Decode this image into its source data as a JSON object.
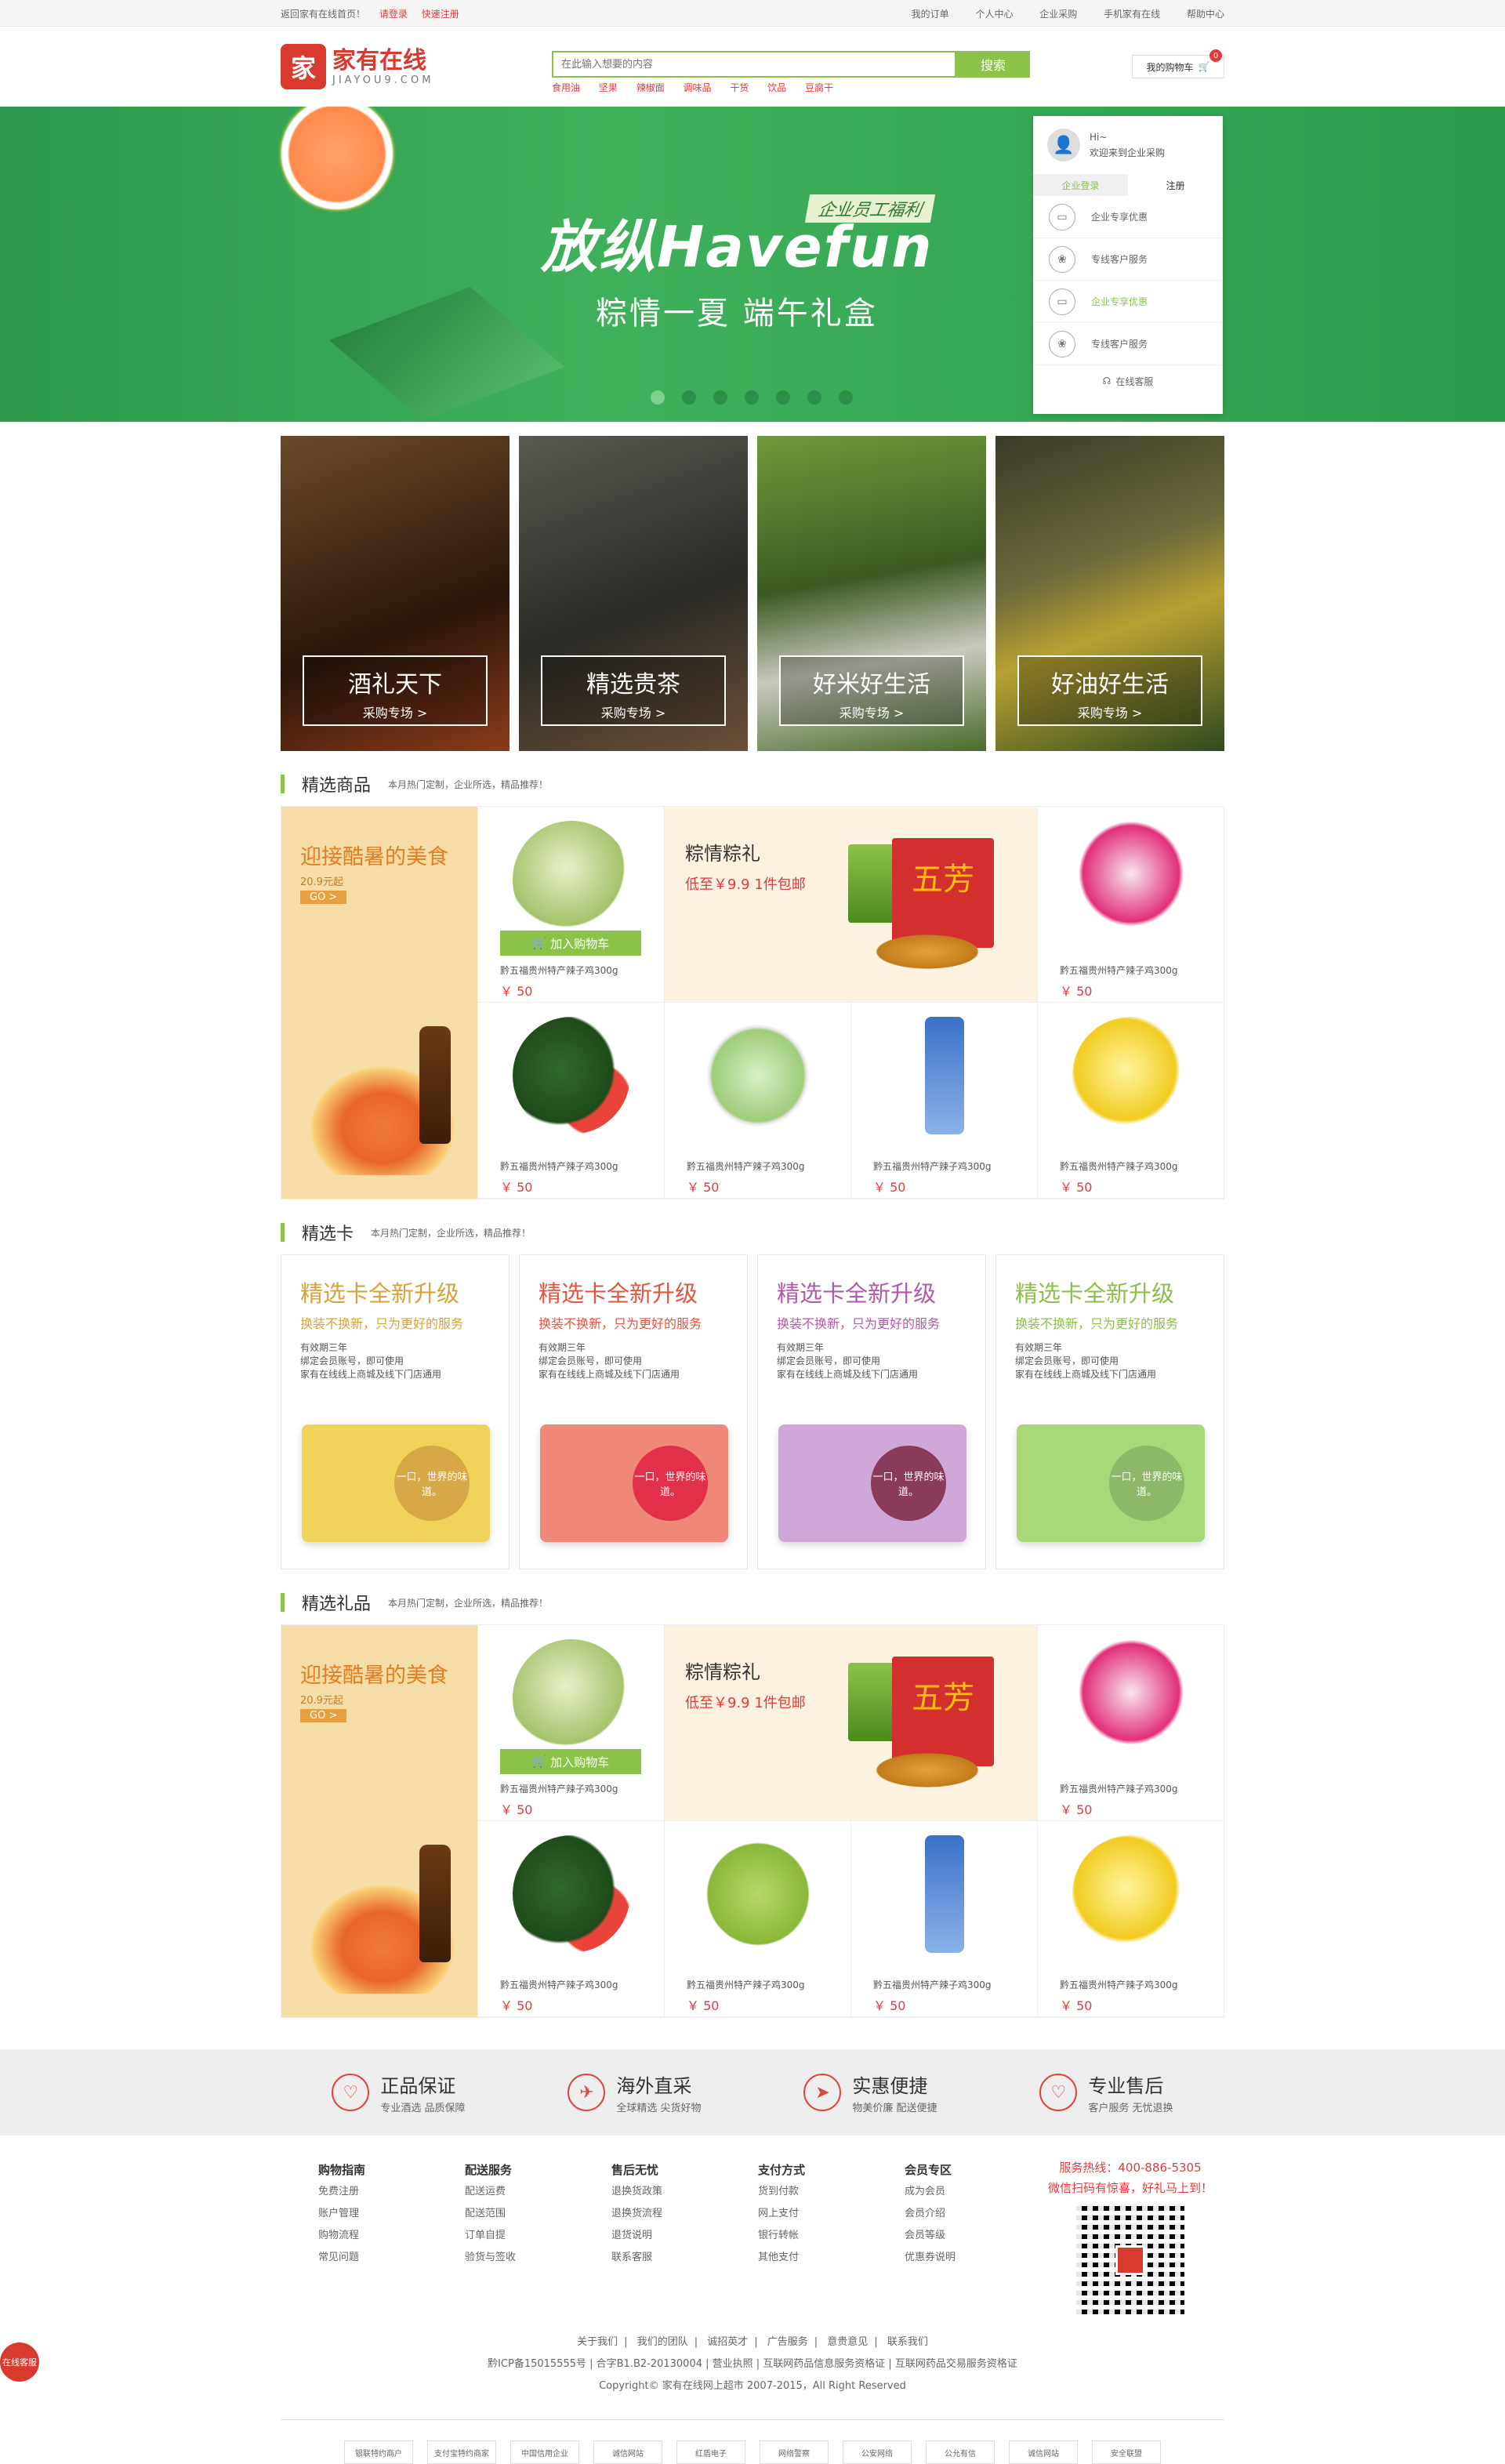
{
  "topbar": {
    "home": "返回家有在线首页！",
    "login": "请登录",
    "register": "快速注册",
    "my_orders": "我的订单",
    "personal": "个人中心",
    "enterprise": "企业采购",
    "mobile": "手机家有在线",
    "help": "帮助中心"
  },
  "header": {
    "logo_cn": "家有在线",
    "logo_en": "JIAYOU9.COM",
    "search_placeholder": "在此输入想要的内容",
    "search_button": "搜索",
    "hotwords": [
      "食用油",
      "坚果",
      "辣椒面",
      "调味品",
      "干货",
      "饮品",
      "豆腐干"
    ],
    "cart_label": "我的购物车",
    "cart_count": "0"
  },
  "banner": {
    "tag": "企业员工福利",
    "headline": "放纵Havefun",
    "subline": "粽情一夏 端午礼盒"
  },
  "login_panel": {
    "greeting": "Hi~",
    "welcome": "欢迎来到企业采购",
    "tab_login": "企业登录",
    "tab_register": "注册",
    "items": [
      "企业专享优惠",
      "专线客户服务",
      "企业专享优惠",
      "专线客户服务"
    ],
    "service": "在线客服"
  },
  "categories": [
    {
      "title": "酒礼天下",
      "sub": "采购专场 >"
    },
    {
      "title": "精选贵茶",
      "sub": "采购专场 >"
    },
    {
      "title": "好米好生活",
      "sub": "采购专场 >"
    },
    {
      "title": "好油好生活",
      "sub": "采购专场 >"
    }
  ],
  "section1": {
    "title": "精选商品",
    "desc": "本月热门定制，企业所选，精品推荐！"
  },
  "section2": {
    "title": "精选卡",
    "desc": "本月热门定制，企业所选，精品推荐！"
  },
  "section3": {
    "title": "精选礼品",
    "desc": "本月热门定制，企业所选，精品推荐！"
  },
  "promo": {
    "title": "迎接酷暑的美食",
    "price": "20.9元起",
    "go": "GO >"
  },
  "feature": {
    "title": "粽情粽礼",
    "price": "低至￥9.9 1件包邮",
    "box_text": "五芳"
  },
  "product": {
    "name": "黔五福贵州特产辣子鸡300g",
    "price": "￥ 50",
    "add_cart": "加入购物车"
  },
  "cards": [
    {
      "title": "精选卡全新升级",
      "sub": "换装不换新，只为更好的服务",
      "lines": [
        "有效期三年",
        "绑定会员账号，即可使用",
        "家有在线线上商城及线下门店通用"
      ],
      "circle": "一口，世界的味道。"
    },
    {
      "title": "精选卡全新升级",
      "sub": "换装不换新，只为更好的服务",
      "lines": [
        "有效期三年",
        "绑定会员账号，即可使用",
        "家有在线线上商城及线下门店通用"
      ],
      "circle": "一口，世界的味道。"
    },
    {
      "title": "精选卡全新升级",
      "sub": "换装不换新，只为更好的服务",
      "lines": [
        "有效期三年",
        "绑定会员账号，即可使用",
        "家有在线线上商城及线下门店通用"
      ],
      "circle": "一口，世界的味道。"
    },
    {
      "title": "精选卡全新升级",
      "sub": "换装不换新，只为更好的服务",
      "lines": [
        "有效期三年",
        "绑定会员账号，即可使用",
        "家有在线线上商城及线下门店通用"
      ],
      "circle": "一口，世界的味道。"
    }
  ],
  "guarantees": [
    {
      "title": "正品保证",
      "sub": "专业酒选 品质保障",
      "icon": "♡"
    },
    {
      "title": "海外直采",
      "sub": "全球精选 尖货好物",
      "icon": "✈"
    },
    {
      "title": "实惠便捷",
      "sub": "物美价廉 配送便捷",
      "icon": "➤"
    },
    {
      "title": "专业售后",
      "sub": "客户服务 无忧退换",
      "icon": "♡"
    }
  ],
  "footer_cols": [
    {
      "head": "购物指南",
      "items": [
        "免费注册",
        "账户管理",
        "购物流程",
        "常见问题"
      ]
    },
    {
      "head": "配送服务",
      "items": [
        "配送运费",
        "配送范围",
        "订单自提",
        "验货与签收"
      ]
    },
    {
      "head": "售后无忧",
      "items": [
        "退换货政策",
        "退换货流程",
        "退货说明",
        "联系客服"
      ]
    },
    {
      "head": "支付方式",
      "items": [
        "货到付款",
        "网上支付",
        "银行转帐",
        "其他支付"
      ]
    },
    {
      "head": "会员专区",
      "items": [
        "成为会员",
        "会员介绍",
        "会员等级",
        "优惠券说明"
      ]
    }
  ],
  "footer_hot": {
    "hotline": "服务热线：400-886-5305",
    "slogan": "微信扫码有惊喜，好礼马上到！"
  },
  "bottom": {
    "links": [
      "关于我们",
      "我们的团队",
      "诚招英才",
      "广告服务",
      "意贵意见",
      "联系我们"
    ],
    "icp": "黔ICP备15015555号 | 合字B1.B2-20130004 | 营业执照 | 互联网药品信息服务资格证 | 互联网药品交易服务资格证",
    "copyright": "Copyright© 家有在线网上超市 2007-2015，All Right Reserved"
  },
  "badges": [
    "银联特约商户",
    "支付宝特约商家",
    "中国信用企业",
    "诚信网站",
    "红盾电子",
    "网络警察",
    "公安网络",
    "公允有信",
    "诚信网站",
    "安全联盟"
  ],
  "online_service": "在线客服"
}
